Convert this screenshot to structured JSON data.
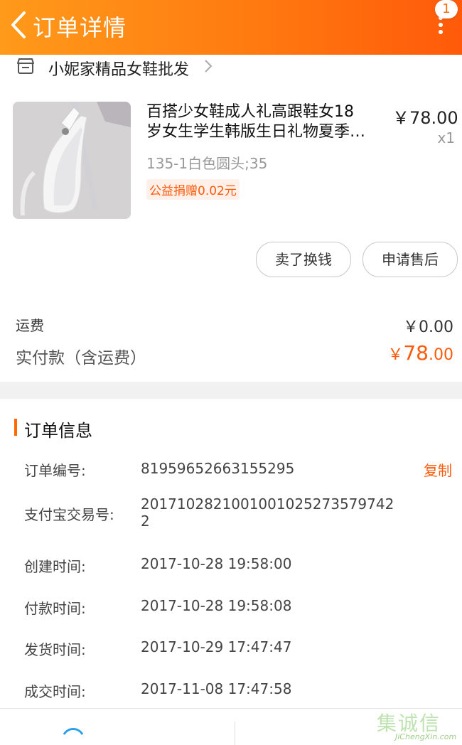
{
  "header": {
    "title": "订单详情",
    "badge_count": "1",
    "back_icon": "chevron-left-icon",
    "more_icon": "more-vertical-icon"
  },
  "shop": {
    "name": "小妮家精品女鞋批发",
    "icon": "store-icon"
  },
  "product": {
    "title_line1": "百搭少女鞋成人礼高跟鞋女18",
    "title_line2": "岁女生学生韩版生日礼物夏季…",
    "price": "￥78.00",
    "quantity": "x1",
    "spec": "135-1白色圆头;35",
    "charity": "公益捐赠0.02元"
  },
  "actions": {
    "sell": "卖了换钱",
    "after_sale": "申请售后"
  },
  "summary": {
    "shipping_label": "运费",
    "shipping_value": "￥0.00",
    "paid_label": "实付款（含运费）",
    "paid_symbol": "￥",
    "paid_int": "78",
    "paid_dec": ".00"
  },
  "order_info": {
    "title": "订单信息",
    "copy_label": "复制",
    "rows": [
      {
        "label": "订单编号:",
        "value": "81959652663155295"
      },
      {
        "label": "支付宝交易号:",
        "value_line1": "2017102821001001025273579742",
        "value_line2": "2"
      },
      {
        "label": "创建时间:",
        "value": "2017-10-28 19:58:00"
      },
      {
        "label": "付款时间:",
        "value": "2017-10-28 19:58:08"
      },
      {
        "label": "发货时间:",
        "value": "2017-10-29 17:47:47"
      },
      {
        "label": "成交时间:",
        "value": "2017-11-08 17:47:58"
      }
    ]
  },
  "watermark": {
    "text": "集诚信",
    "sub": "JiChengXin.com"
  },
  "colors": {
    "accent": "#ff6a00",
    "header_start": "#ff9a1a",
    "header_end": "#ff5a0a"
  }
}
